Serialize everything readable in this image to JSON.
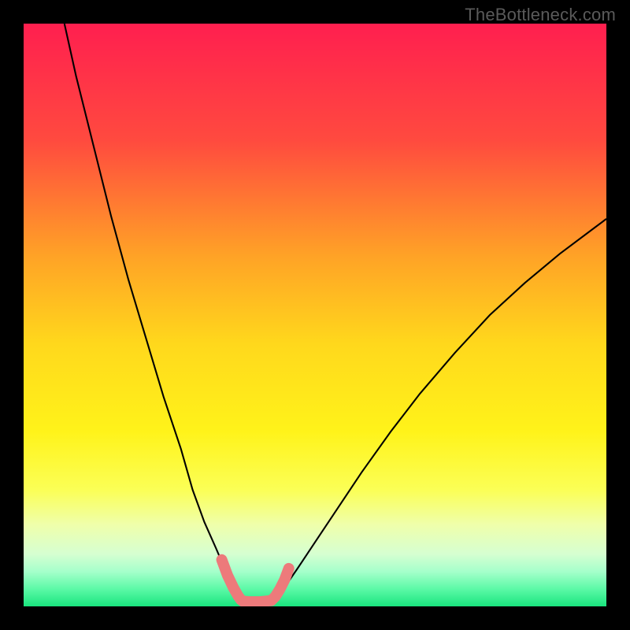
{
  "watermark": {
    "text": "TheBottleneck.com"
  },
  "chart_data": {
    "type": "line",
    "title": "",
    "xlabel": "",
    "ylabel": "",
    "xlim": [
      0,
      100
    ],
    "ylim": [
      0,
      100
    ],
    "grid": false,
    "legend": false,
    "series": [
      {
        "name": "left-curve",
        "x": [
          7,
          9,
          12,
          15,
          18,
          21,
          24,
          27,
          29,
          31,
          33,
          34.5,
          35.5,
          36.3,
          37,
          37.5
        ],
        "y": [
          100,
          91,
          79,
          67,
          56,
          46,
          36,
          27,
          20,
          14.5,
          10,
          6.5,
          4.2,
          2.7,
          1.6,
          1.0
        ]
      },
      {
        "name": "right-curve",
        "x": [
          42.5,
          43.5,
          45,
          47,
          50,
          54,
          58,
          63,
          68,
          74,
          80,
          86,
          92,
          98,
          100
        ],
        "y": [
          1.0,
          1.8,
          3.6,
          6.5,
          11,
          17,
          23,
          30,
          36.5,
          43.5,
          50,
          55.5,
          60.5,
          65,
          66.5
        ]
      },
      {
        "name": "marker-left",
        "x": [
          34.0,
          35.0,
          36.0,
          36.8,
          37.3,
          37.6
        ],
        "y": [
          8.0,
          5.3,
          3.2,
          1.8,
          1.1,
          0.9
        ]
      },
      {
        "name": "marker-floor",
        "x": [
          37.6,
          38.6,
          39.6,
          40.6,
          41.6,
          42.5
        ],
        "y": [
          0.9,
          0.8,
          0.8,
          0.8,
          0.9,
          1.0
        ]
      },
      {
        "name": "marker-right",
        "x": [
          42.5,
          43.2,
          44.0,
          44.8,
          45.5
        ],
        "y": [
          1.0,
          1.7,
          3.0,
          4.6,
          6.5
        ]
      }
    ],
    "background": {
      "type": "vertical-gradient",
      "stops": [
        {
          "offset": 0.0,
          "color": "#ff1f4f"
        },
        {
          "offset": 0.2,
          "color": "#ff4a3f"
        },
        {
          "offset": 0.4,
          "color": "#ffa326"
        },
        {
          "offset": 0.55,
          "color": "#ffd81c"
        },
        {
          "offset": 0.7,
          "color": "#fff31a"
        },
        {
          "offset": 0.8,
          "color": "#fbff56"
        },
        {
          "offset": 0.86,
          "color": "#efffab"
        },
        {
          "offset": 0.91,
          "color": "#d6ffd1"
        },
        {
          "offset": 0.94,
          "color": "#a6ffcb"
        },
        {
          "offset": 0.97,
          "color": "#5cf9a7"
        },
        {
          "offset": 1.0,
          "color": "#19e57e"
        }
      ]
    }
  }
}
